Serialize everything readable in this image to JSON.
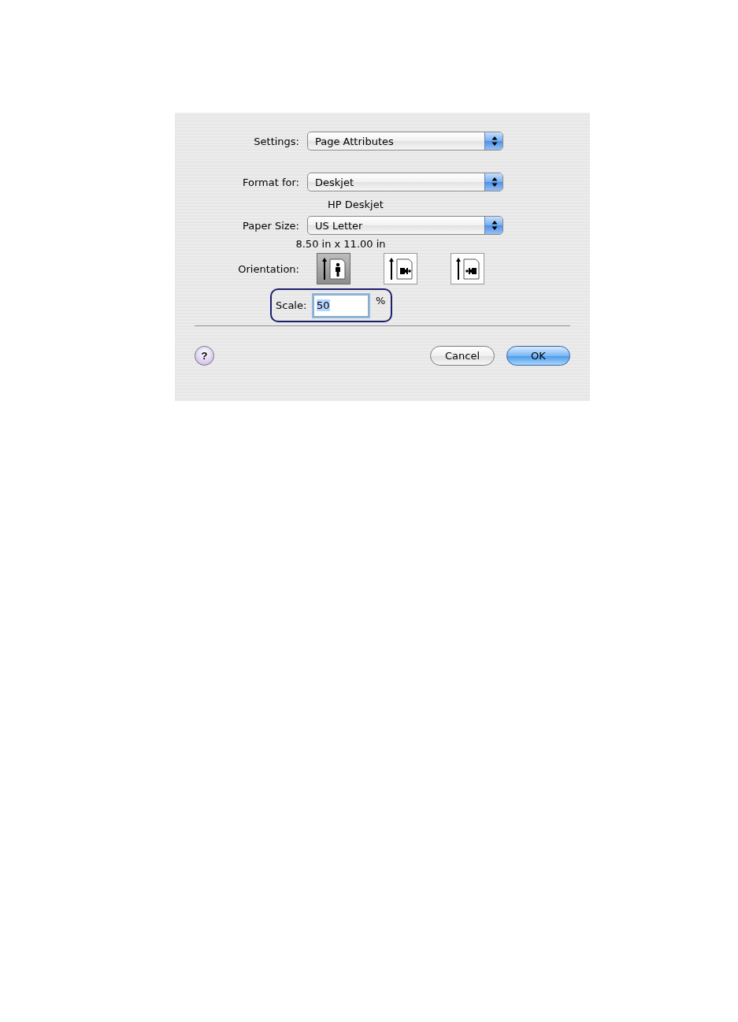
{
  "settings": {
    "label": "Settings:",
    "value": "Page Attributes"
  },
  "format_for": {
    "label": "Format for:",
    "value": "Deskjet",
    "description": "HP Deskjet"
  },
  "paper_size": {
    "label": "Paper Size:",
    "value": "US Letter",
    "description": "8.50 in x 11.00 in"
  },
  "orientation": {
    "label": "Orientation:",
    "options": [
      {
        "kind": "portrait",
        "selected": true
      },
      {
        "kind": "landscape",
        "selected": false
      },
      {
        "kind": "reverse_landscape",
        "selected": false
      }
    ]
  },
  "scale": {
    "label": "Scale:",
    "value": "50",
    "unit": "%",
    "highlighted": true,
    "value_selected": true
  },
  "buttons": [
    {
      "kind": "help",
      "label": "?"
    },
    {
      "kind": "cancel",
      "label": "Cancel",
      "default": false
    },
    {
      "kind": "ok",
      "label": "OK",
      "default": true
    }
  ]
}
